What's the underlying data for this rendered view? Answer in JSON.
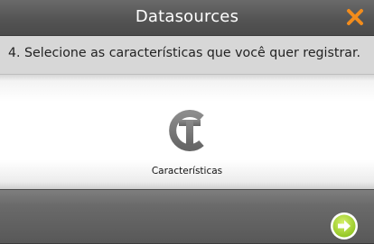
{
  "window": {
    "title": "Datasources",
    "close_icon": "close-x-icon",
    "close_color": "#f28c1c"
  },
  "instruction": {
    "text": "4. Selecione as características que você quer registrar."
  },
  "features": {
    "items": [
      {
        "label": "Características",
        "icon": "ct-logo-icon",
        "icon_color": "#7a7a7a"
      }
    ]
  },
  "footer": {
    "next_icon": "next-arrow-icon",
    "next_color": "#9bd02a"
  }
}
